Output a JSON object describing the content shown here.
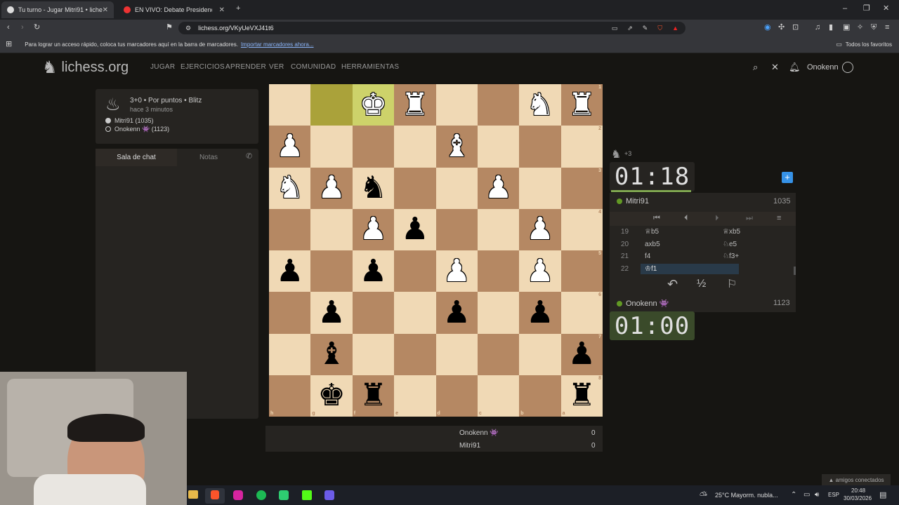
{
  "browser": {
    "tabs": [
      {
        "title": "Tu turno - Jugar Mitri91 • liches",
        "active": true
      },
      {
        "title": "EN VIVO: Debate Presidencial",
        "active": false
      }
    ],
    "url": "lichess.org/VKyUeVXJ41t6",
    "bookmarks_bar_text": "Para lograr un acceso rápido, coloca tus marcadores aquí en la barra de marcadores.",
    "bookmarks_import_link": "Importar marcadores ahora...",
    "all_favorites": "Todos los favoritos"
  },
  "site": {
    "logo_text": "lichess.org",
    "nav": [
      "JUGAR",
      "EJERCICIOS",
      "APRENDER",
      "VER",
      "COMUNIDAD",
      "HERRAMIENTAS"
    ],
    "username": "Onokenn"
  },
  "game_info": {
    "mode": "3+0 • Por puntos • Blitz",
    "time_ago": "hace 3 minutos",
    "white_player": "Mitri91 (1035)",
    "black_player": "Onokenn 👾 (1123)"
  },
  "chat": {
    "tab_chat": "Sala de chat",
    "tab_notes": "Notas"
  },
  "board": {
    "highlight_squares": [
      "b8-hl",
      "c8-hl2"
    ],
    "ranks": [
      "1",
      "2",
      "3",
      "4",
      "5",
      "6",
      "7",
      "8"
    ],
    "files": [
      "h",
      "g",
      "f",
      "e",
      "d",
      "c",
      "b",
      "a"
    ],
    "rows": [
      [
        {
          "p": "",
          "c": ""
        },
        {
          "p": "",
          "c": ""
        },
        {
          "p": "♚",
          "c": "w"
        },
        {
          "p": "♜",
          "c": "w"
        },
        {
          "p": "",
          "c": ""
        },
        {
          "p": "",
          "c": ""
        },
        {
          "p": "♞",
          "c": "w"
        },
        {
          "p": "♜",
          "c": "w"
        }
      ],
      [
        {
          "p": "♟",
          "c": "w"
        },
        {
          "p": "",
          "c": ""
        },
        {
          "p": "",
          "c": ""
        },
        {
          "p": "",
          "c": ""
        },
        {
          "p": "♝",
          "c": "w"
        },
        {
          "p": "",
          "c": ""
        },
        {
          "p": "",
          "c": ""
        },
        {
          "p": "",
          "c": ""
        }
      ],
      [
        {
          "p": "♞",
          "c": "w"
        },
        {
          "p": "♟",
          "c": "w"
        },
        {
          "p": "♞",
          "c": "b"
        },
        {
          "p": "",
          "c": ""
        },
        {
          "p": "",
          "c": ""
        },
        {
          "p": "♟",
          "c": "w"
        },
        {
          "p": "",
          "c": ""
        },
        {
          "p": "",
          "c": ""
        }
      ],
      [
        {
          "p": "",
          "c": ""
        },
        {
          "p": "",
          "c": ""
        },
        {
          "p": "♟",
          "c": "w"
        },
        {
          "p": "♟",
          "c": "b"
        },
        {
          "p": "",
          "c": ""
        },
        {
          "p": "",
          "c": ""
        },
        {
          "p": "♟",
          "c": "w"
        },
        {
          "p": "",
          "c": ""
        }
      ],
      [
        {
          "p": "♟",
          "c": "b"
        },
        {
          "p": "",
          "c": ""
        },
        {
          "p": "♟",
          "c": "b"
        },
        {
          "p": "",
          "c": ""
        },
        {
          "p": "♟",
          "c": "w"
        },
        {
          "p": "",
          "c": ""
        },
        {
          "p": "♟",
          "c": "w"
        },
        {
          "p": "",
          "c": ""
        }
      ],
      [
        {
          "p": "",
          "c": ""
        },
        {
          "p": "♟",
          "c": "b"
        },
        {
          "p": "",
          "c": ""
        },
        {
          "p": "",
          "c": ""
        },
        {
          "p": "♟",
          "c": "b"
        },
        {
          "p": "",
          "c": ""
        },
        {
          "p": "♟",
          "c": "b"
        },
        {
          "p": "",
          "c": ""
        }
      ],
      [
        {
          "p": "",
          "c": ""
        },
        {
          "p": "♝",
          "c": "b"
        },
        {
          "p": "",
          "c": ""
        },
        {
          "p": "",
          "c": ""
        },
        {
          "p": "",
          "c": ""
        },
        {
          "p": "",
          "c": ""
        },
        {
          "p": "",
          "c": ""
        },
        {
          "p": "♟",
          "c": "b"
        }
      ],
      [
        {
          "p": "",
          "c": ""
        },
        {
          "p": "♚",
          "c": "b"
        },
        {
          "p": "♜",
          "c": "b"
        },
        {
          "p": "",
          "c": ""
        },
        {
          "p": "",
          "c": ""
        },
        {
          "p": "",
          "c": ""
        },
        {
          "p": "",
          "c": ""
        },
        {
          "p": "♜",
          "c": "b"
        }
      ]
    ]
  },
  "opponent": {
    "material": "+3",
    "clock": "01:18",
    "name": "Mitri91",
    "rating": "1035"
  },
  "moves": [
    {
      "n": "19",
      "w": "♕b5",
      "b": "♕xb5"
    },
    {
      "n": "20",
      "w": "axb5",
      "b": "♘e5"
    },
    {
      "n": "21",
      "w": "f4",
      "b": "♘f3+"
    },
    {
      "n": "22",
      "w": "♔f1",
      "b": ""
    }
  ],
  "me": {
    "name": "Onokenn 👾",
    "rating": "1123",
    "clock": "01:00"
  },
  "scores": [
    {
      "name": "Onokenn 👾",
      "score": "0"
    },
    {
      "name": "Mitri91",
      "score": "0"
    }
  ],
  "taskbar": {
    "weather": "25°C  Mayorm. nubla...",
    "lang": "ESP",
    "time": "20:48",
    "date": "30/03/2026",
    "friends": "▲ amigos conectados"
  }
}
